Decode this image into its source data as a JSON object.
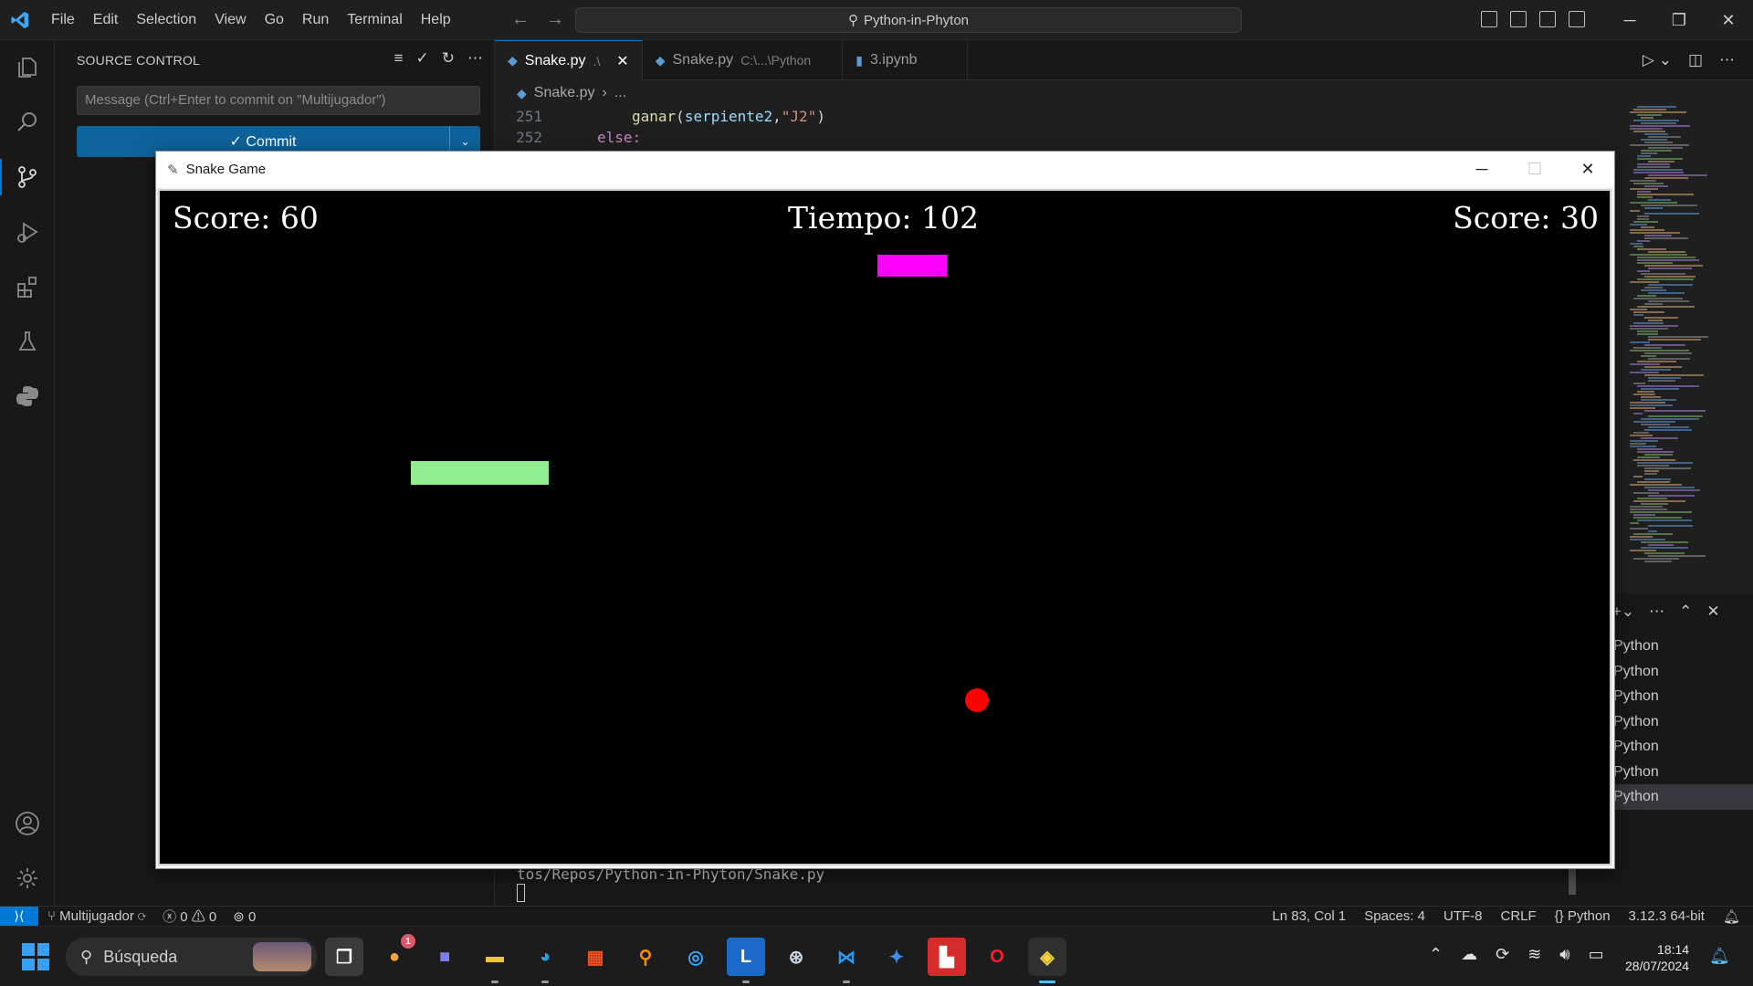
{
  "menu": [
    "File",
    "Edit",
    "Selection",
    "View",
    "Go",
    "Run",
    "Terminal",
    "Help"
  ],
  "command_center": "Python-in-Phyton",
  "sidebar": {
    "title": "SOURCE CONTROL",
    "commit_placeholder": "Message (Ctrl+Enter to commit on \"Multijugador\")",
    "commit_label": "✓ Commit"
  },
  "tabs": [
    {
      "label": "Snake.py",
      "path": ".\\",
      "active": true
    },
    {
      "label": "Snake.py",
      "path": "C:\\...\\Python",
      "active": false
    },
    {
      "label": "3.ipynb",
      "path": "",
      "active": false
    }
  ],
  "breadcrumb": {
    "file": "Snake.py",
    "rest": "..."
  },
  "code": [
    {
      "line": "251",
      "text": "ganar(serpiente2,\"J2\")"
    },
    {
      "line": "252",
      "text": "else:"
    }
  ],
  "terminal": {
    "items": [
      "Python",
      "Python",
      "Python",
      "Python",
      "Python",
      "Python",
      "Python"
    ],
    "selected_index": 6,
    "last_line": "tos/Repos/Python-in-Phyton/Snake.py"
  },
  "snake_window": {
    "title": "Snake Game",
    "score_left": "Score: 60",
    "time": "Tiempo: 102",
    "score_right": "Score: 30"
  },
  "colors": {
    "snake1": "#90ee90",
    "snake2": "#ff00ff",
    "food": "#ff0000",
    "accent": "#0078d4"
  },
  "statusbar": {
    "branch": "Multijugador",
    "errors": "0",
    "warnings": "0",
    "ports": "0",
    "position": "Ln 83, Col 1",
    "spaces": "Spaces: 4",
    "encoding": "UTF-8",
    "eol": "CRLF",
    "language": "Python",
    "interpreter": "3.12.3 64-bit"
  },
  "taskbar": {
    "search_label": "Búsqueda",
    "time": "18:14",
    "date": "28/07/2024",
    "badge": "1"
  }
}
